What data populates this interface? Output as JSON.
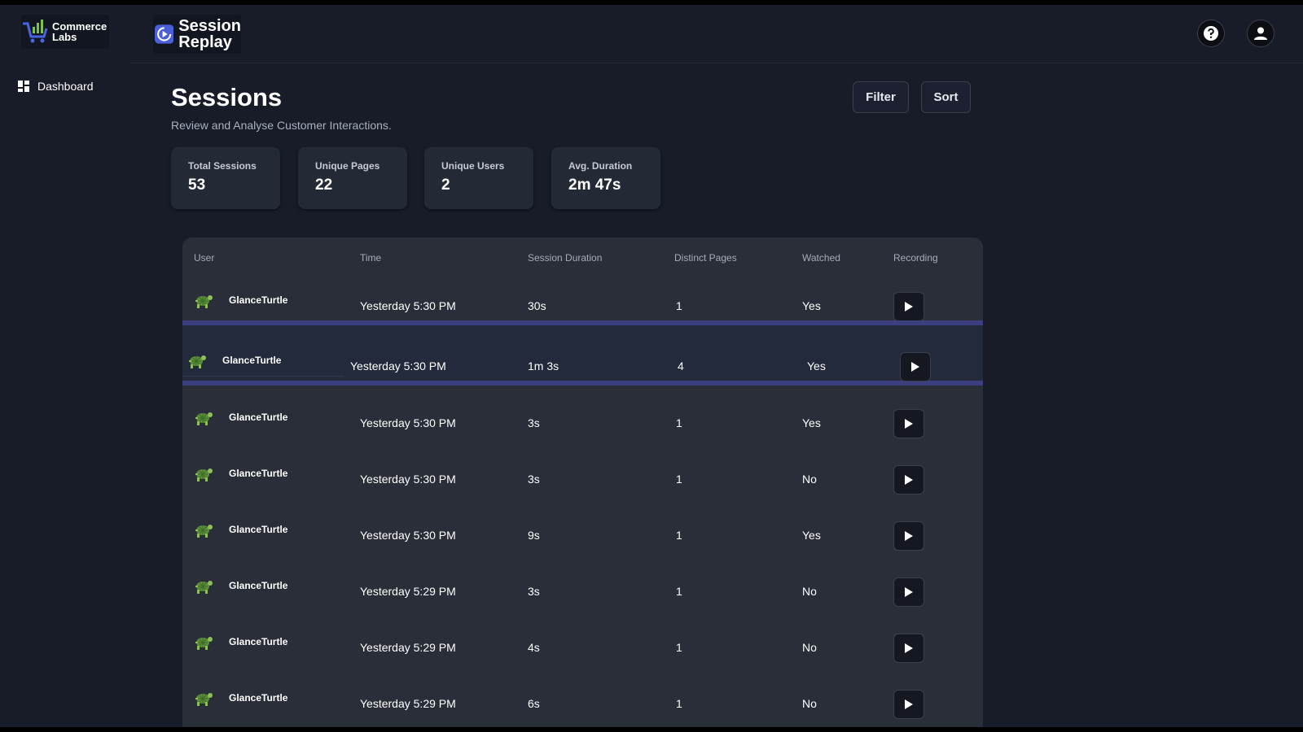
{
  "brand": {
    "company_name_line1": "Commerce",
    "company_name_line2": "Labs",
    "product_name_line1": "Session",
    "product_name_line2": "Replay"
  },
  "header": {
    "help_icon": "help-circle-icon",
    "profile_icon": "user-avatar-icon"
  },
  "sidebar": {
    "items": [
      {
        "label": "Dashboard",
        "icon": "dashboard-grid-icon"
      }
    ]
  },
  "page": {
    "title": "Sessions",
    "subtitle": "Review and Analyse Customer Interactions."
  },
  "toolbar": {
    "filter_label": "Filter",
    "sort_label": "Sort"
  },
  "stats": [
    {
      "label": "Total Sessions",
      "value": "53"
    },
    {
      "label": "Unique Pages",
      "value": "22"
    },
    {
      "label": "Unique Users",
      "value": "2"
    },
    {
      "label": "Avg. Duration",
      "value": "2m 47s"
    }
  ],
  "table": {
    "columns": [
      "User",
      "Time",
      "Session Duration",
      "Distinct Pages",
      "Watched",
      "Recording"
    ],
    "rows": [
      {
        "user": "GlanceTurtle",
        "time": "Yesterday 5:30 PM",
        "duration": "30s",
        "pages": "1",
        "watched": "Yes"
      },
      {
        "user": "GlanceTurtle",
        "time": "Yesterday 5:30 PM",
        "duration": "1m 3s",
        "pages": "4",
        "watched": "Yes"
      },
      {
        "user": "GlanceTurtle",
        "time": "Yesterday 5:30 PM",
        "duration": "3s",
        "pages": "1",
        "watched": "Yes"
      },
      {
        "user": "GlanceTurtle",
        "time": "Yesterday 5:30 PM",
        "duration": "3s",
        "pages": "1",
        "watched": "No"
      },
      {
        "user": "GlanceTurtle",
        "time": "Yesterday 5:30 PM",
        "duration": "9s",
        "pages": "1",
        "watched": "Yes"
      },
      {
        "user": "GlanceTurtle",
        "time": "Yesterday 5:29 PM",
        "duration": "3s",
        "pages": "1",
        "watched": "No"
      },
      {
        "user": "GlanceTurtle",
        "time": "Yesterday 5:29 PM",
        "duration": "4s",
        "pages": "1",
        "watched": "No"
      },
      {
        "user": "GlanceTurtle",
        "time": "Yesterday 5:29 PM",
        "duration": "6s",
        "pages": "1",
        "watched": "No"
      }
    ]
  },
  "colors": {
    "background": "#181c28",
    "card": "#242936",
    "table": "#2a2e38",
    "highlight": "#3b3f7e",
    "accent": "#4b5fd6"
  }
}
